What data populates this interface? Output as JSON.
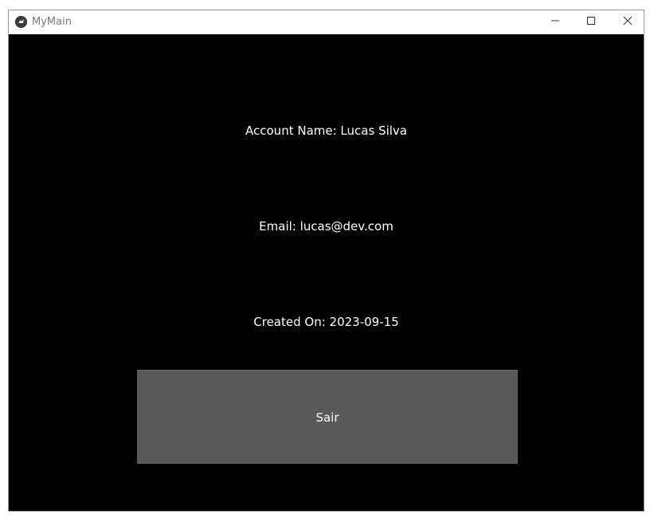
{
  "window": {
    "title": "MyMain",
    "icon": "kivy-app-icon"
  },
  "title_controls": {
    "minimize_icon": "minimize-icon",
    "maximize_icon": "maximize-icon",
    "close_icon": "close-icon"
  },
  "account": {
    "name_line": "Account Name: Lucas Silva",
    "email_line": "Email: lucas@dev.com",
    "created_line": "Created On: 2023-09-15"
  },
  "actions": {
    "exit_label": "Sair"
  },
  "colors": {
    "background": "#000000",
    "button": "#595959",
    "text": "#ffffff",
    "titlebar": "#ffffff"
  }
}
